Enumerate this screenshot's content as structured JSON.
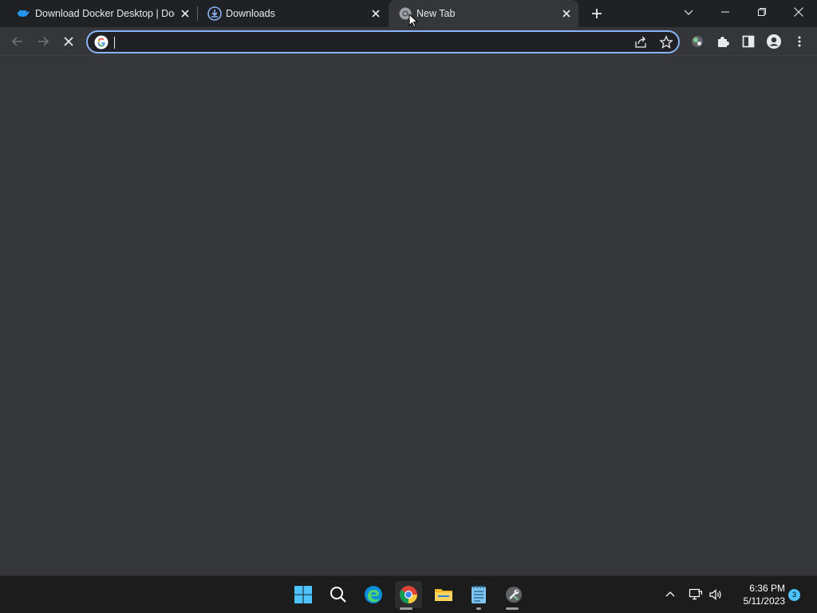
{
  "browser": {
    "tabs": [
      {
        "label": "Download Docker Desktop | Docker",
        "icon": "docker-icon",
        "active": false
      },
      {
        "label": "Downloads",
        "icon": "download-icon",
        "active": false
      },
      {
        "label": "New Tab",
        "icon": "chrome-icon",
        "active": true
      }
    ],
    "omnibox": {
      "value": "",
      "placeholder": ""
    }
  },
  "taskbar": {
    "time": "6:36 PM",
    "date": "5/11/2023",
    "notification_count": "3"
  },
  "colors": {
    "accent": "#8ab4f8",
    "tabstrip": "#202124",
    "toolbar": "#35363a",
    "taskbar": "#1c1c1c"
  }
}
